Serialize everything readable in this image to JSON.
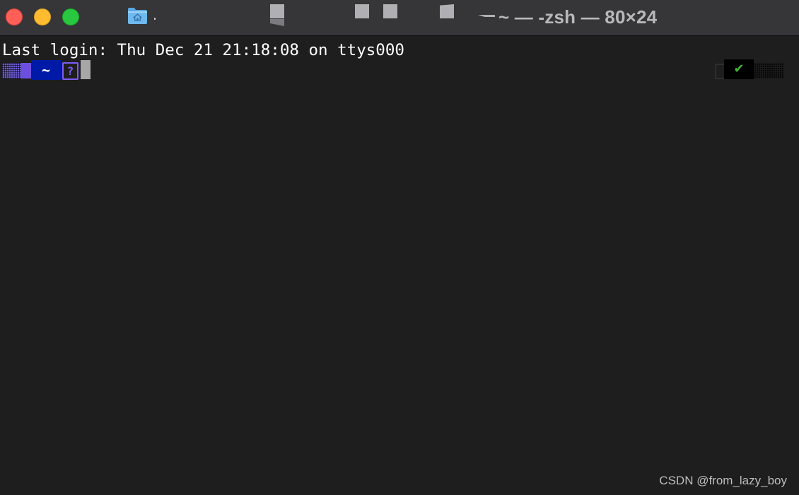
{
  "window": {
    "title": "~ — -zsh — 80×24"
  },
  "traffic_lights": {
    "close_color": "#ff5f57",
    "minimize_color": "#febc2e",
    "maximize_color": "#28c840"
  },
  "titlebar": {
    "proxy_icon": "home-folder-icon"
  },
  "terminal": {
    "background": "#1e1e1e",
    "lines": [
      "Last login: Thu Dec 21 21:18:08 on ttys000"
    ],
    "prompt": {
      "directory": "~",
      "unknown_glyph": "?",
      "status_glyph": "✔",
      "status_color": "#45b13a",
      "directory_bg": "#001aa8"
    }
  },
  "watermark": "CSDN @from_lazy_boy"
}
